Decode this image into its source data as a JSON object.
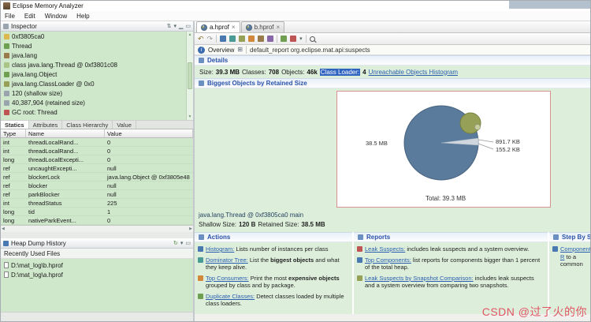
{
  "window": {
    "title": "Eclipse Memory Analyzer",
    "menus": [
      "File",
      "Edit",
      "Window",
      "Help"
    ]
  },
  "icons": {
    "close": "×",
    "dropdown": "▾",
    "back": "↶",
    "forward": "↷",
    "info": "i",
    "grid": "⊞",
    "up": "▲",
    "down": "▼",
    "left": "◀",
    "right": "▶",
    "refresh": "↻",
    "minimize": "▁",
    "maximize": "▭",
    "link_editor": "⇅"
  },
  "inspector": {
    "title": "Inspector",
    "tree": [
      "0xf3805ca0",
      "Thread",
      "java.lang",
      "class java.lang.Thread @ 0xf3801c08",
      "java.lang.Object",
      "java.lang.ClassLoader @ 0x0",
      "120 (shallow size)",
      "40,387,904 (retained size)",
      "GC root: Thread"
    ],
    "tabs": [
      "Statics",
      "Attributes",
      "Class Hierarchy",
      "Value"
    ],
    "columns": [
      "Type",
      "Name",
      "Value"
    ],
    "rows": [
      [
        "int",
        "threadLocalRand...",
        "0"
      ],
      [
        "int",
        "threadLocalRand...",
        "0"
      ],
      [
        "long",
        "threadLocalExcepti...",
        "0"
      ],
      [
        "ref",
        "uncaughtExcepti...",
        "null"
      ],
      [
        "ref",
        "blockerLock",
        "java.lang.Object @ 0xf3805e48"
      ],
      [
        "ref",
        "blocker",
        "null"
      ],
      [
        "ref",
        "parkBlocker",
        "null"
      ],
      [
        "int",
        "threadStatus",
        "225"
      ],
      [
        "long",
        "tid",
        "1"
      ],
      [
        "long",
        "nativeParkEvent...",
        "0"
      ]
    ]
  },
  "heap_history": {
    "title": "Heap Dump History",
    "recent_label": "Recently Used Files",
    "files": [
      "D:\\mat_log\\b.hprof",
      "D:\\mat_log\\a.hprof"
    ]
  },
  "editor": {
    "tabs": [
      {
        "label": "a.hprof"
      },
      {
        "label": "b.hprof"
      }
    ],
    "overview": {
      "label": "Overview",
      "path": "default_report org.eclipse.mat.api:suspects"
    },
    "details": {
      "title": "Details",
      "size_label": "Size:",
      "size_value": "39.3 MB",
      "classes_label": "Classes:",
      "classes_value": "708",
      "objects_label": "Objects:",
      "objects_value": "46k",
      "classloader_label": "Class Loader:",
      "classloader_value": "4",
      "link": "Unreachable Objects Histogram"
    },
    "biggest": {
      "title": "Biggest Objects by Retained Size",
      "chart_data": {
        "type": "pie",
        "title": "Biggest Objects by Retained Size",
        "total_label": "Total: 39.3 MB",
        "slices": [
          {
            "label": "java.lang.Thread @ 0xf3805ca0 main",
            "value": "38.5 MB",
            "color": "#5b7b9d"
          },
          {
            "label": "",
            "value": "891.7 KB",
            "color": "#96a057"
          },
          {
            "label": "",
            "value": "155.2 KB",
            "color": "#c7cf9c"
          }
        ]
      },
      "selected_object": "java.lang.Thread @ 0xf3805ca0 main",
      "shallow_label": "Shallow Size:",
      "shallow_value": "120 B",
      "retained_label": "Retained Size:",
      "retained_value": "38.5 MB"
    },
    "actions": {
      "title": "Actions",
      "items": [
        {
          "link": "Histogram:",
          "t1": " Lists number of instances per class",
          "b": "",
          "t2": ""
        },
        {
          "link": "Dominator Tree:",
          "t1": " List the ",
          "b": "biggest objects",
          "t2": " and what they keep alive."
        },
        {
          "link": "Top Consumers:",
          "t1": " Print the most ",
          "b": "expensive objects",
          "t2": " grouped by class and by package."
        },
        {
          "link": "Duplicate Classes:",
          "t1": " Detect classes loaded by multiple class loaders.",
          "b": "",
          "t2": ""
        }
      ]
    },
    "reports": {
      "title": "Reports",
      "items": [
        {
          "link": "Leak Suspects:",
          "t1": " includes leak suspects and a system overview.",
          "b": "",
          "t2": ""
        },
        {
          "link": "Top Components:",
          "t1": " list reports for components bigger than 1 percent of the total heap.",
          "b": "",
          "t2": ""
        },
        {
          "link": "Leak Suspects by Snapshot Comparison:",
          "t1": " includes leak suspects and a system overview from comparing two snapshots.",
          "b": "",
          "t2": ""
        }
      ]
    },
    "step_by_step": {
      "title": "Step By Step",
      "items": [
        {
          "link": "Component R",
          "t1": " to a common",
          "b": "",
          "t2": ""
        }
      ]
    }
  },
  "watermark": "CSDN @过了火的你"
}
